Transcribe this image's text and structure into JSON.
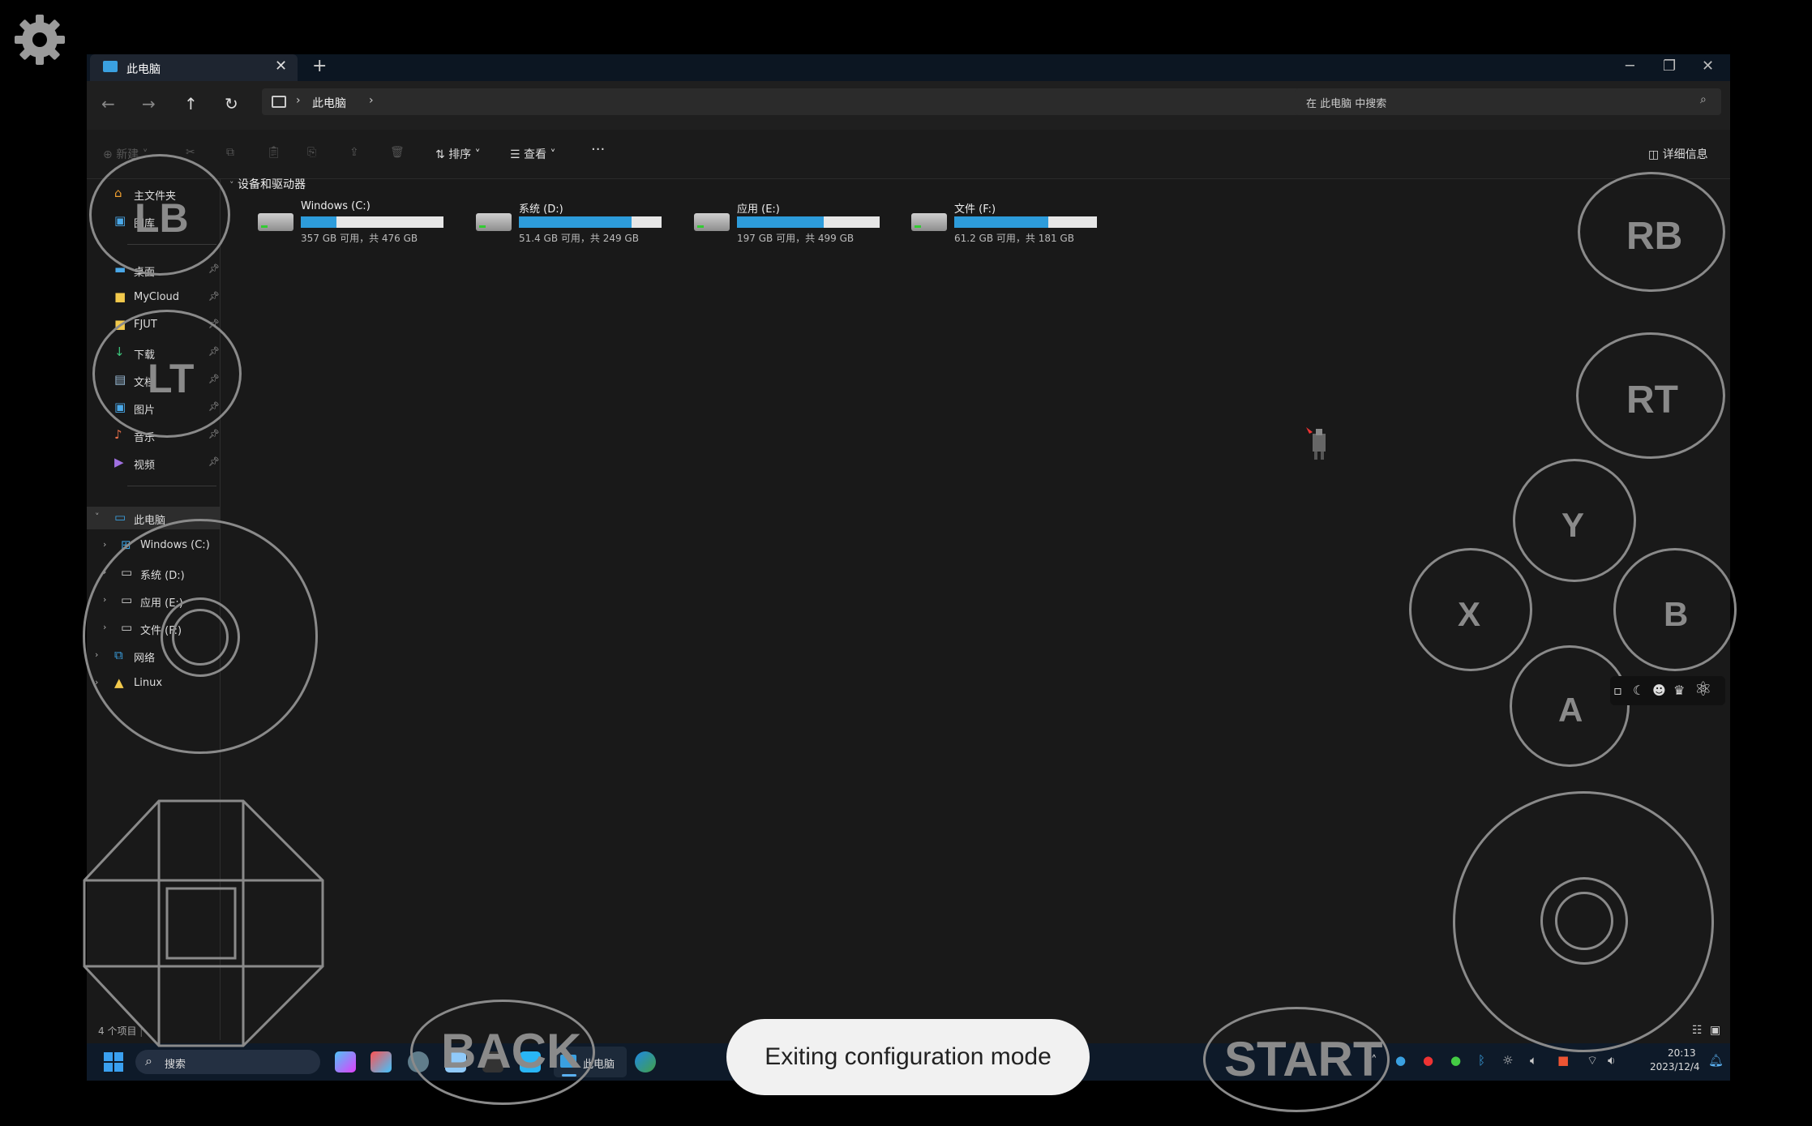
{
  "window": {
    "tab_title": "此电脑",
    "new_tab": "+",
    "min": "─",
    "max": "❐",
    "close": "✕",
    "breadcrumb": [
      "此电脑",
      "›"
    ],
    "search_placeholder": "在 此电脑 中搜索"
  },
  "toolbar": {
    "new": "新建",
    "sort": "排序",
    "view": "查看",
    "more": "···",
    "details": "详细信息"
  },
  "sidebar": {
    "items": [
      {
        "label": "主文件夹",
        "icon": "home-icon",
        "pinned": false
      },
      {
        "label": "图库",
        "icon": "gallery-icon",
        "pinned": false
      },
      {
        "label": "桌面",
        "icon": "desktop-icon",
        "pinned": true
      },
      {
        "label": "MyCloud",
        "icon": "folder-icon",
        "pinned": true
      },
      {
        "label": "FJUT",
        "icon": "folder-icon",
        "pinned": true
      },
      {
        "label": "下载",
        "icon": "download-icon",
        "pinned": true
      },
      {
        "label": "文档",
        "icon": "document-icon",
        "pinned": true
      },
      {
        "label": "图片",
        "icon": "pictures-icon",
        "pinned": true
      },
      {
        "label": "音乐",
        "icon": "music-icon",
        "pinned": true
      },
      {
        "label": "视频",
        "icon": "video-icon",
        "pinned": true
      }
    ],
    "tree": [
      {
        "label": "此电脑",
        "level": 0
      },
      {
        "label": "Windows (C:)",
        "level": 1
      },
      {
        "label": "系统 (D:)",
        "level": 1
      },
      {
        "label": "应用 (E:)",
        "level": 1
      },
      {
        "label": "文件 (F:)",
        "level": 1
      },
      {
        "label": "网络",
        "level": 0
      },
      {
        "label": "Linux",
        "level": 0
      }
    ]
  },
  "content": {
    "section_title": "设备和驱动器",
    "drives": [
      {
        "name": "Windows (C:)",
        "free": "357 GB 可用，共 476 GB",
        "used_fraction": 0.25
      },
      {
        "name": "系统 (D:)",
        "free": "51.4 GB 可用，共 249 GB",
        "used_fraction": 0.79
      },
      {
        "name": "应用 (E:)",
        "free": "197 GB 可用，共 499 GB",
        "used_fraction": 0.61
      },
      {
        "name": "文件 (F:)",
        "free": "61.2 GB 可用，共 181 GB",
        "used_fraction": 0.66
      }
    ]
  },
  "status_bar": {
    "item_count": "4 个项目"
  },
  "taskbar": {
    "search_label": "搜索",
    "active_app_label": "此电脑",
    "time": "20:13",
    "date": "2023/12/4"
  },
  "gamepad_overlay": {
    "buttons": {
      "lb": "LB",
      "lt": "LT",
      "rb": "RB",
      "rt": "RT",
      "y": "Y",
      "x": "X",
      "b": "B",
      "a": "A",
      "back": "BACK",
      "start": "START"
    }
  },
  "toast": {
    "message": "Exiting configuration mode"
  }
}
